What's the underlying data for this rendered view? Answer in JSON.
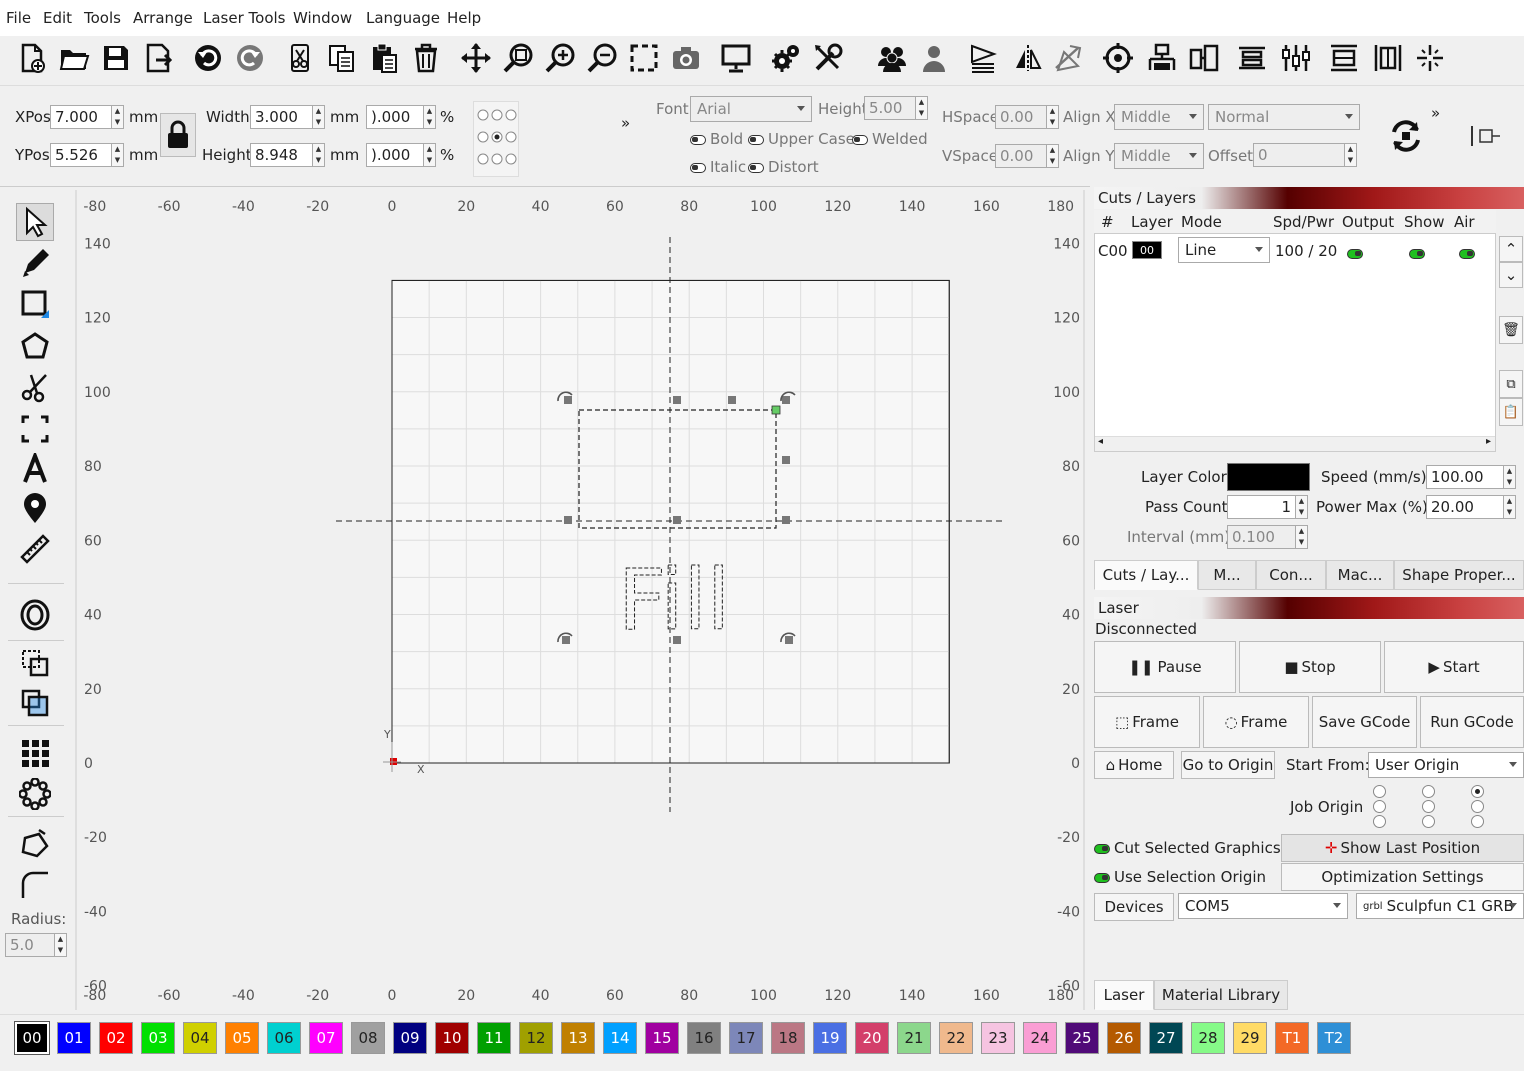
{
  "menu": [
    "File",
    "Edit",
    "Tools",
    "Arrange",
    "Laser Tools",
    "Window",
    "Language",
    "Help"
  ],
  "toolbar_icons": [
    "new-file-icon",
    "open-folder-icon",
    "save-icon",
    "export-icon",
    "undo-icon",
    "redo-icon",
    "cut-icon",
    "copy-icon",
    "paste-icon",
    "delete-icon",
    "move-icon",
    "zoom-to-page-icon",
    "zoom-in-icon",
    "zoom-out-icon",
    "select-frame-icon",
    "camera-icon",
    "monitor-icon",
    "settings-icon",
    "tools-icon",
    "group-icon",
    "ungroup-icon",
    "mirror-horizontal-icon",
    "flip-icon",
    "rotate-icon",
    "target-icon",
    "align-top-icon",
    "align-center-icon",
    "distribute-h-icon",
    "distribute-v-icon",
    "align-width-icon",
    "align-height-icon",
    "snap-icon"
  ],
  "props": {
    "xpos_label": "XPos",
    "xpos": "7.000",
    "ypos_label": "YPos",
    "ypos": "5.526",
    "unit_mm": "mm",
    "width_label": "Width",
    "width": "3.000",
    "height_label": "Height",
    "height": "8.948",
    "scale_w": ").000",
    "scale_h": ").000",
    "percent": "%",
    "more": "»",
    "font_label": "Font",
    "font": "Arial",
    "fheight_label": "Height",
    "fheight": "5.00",
    "bold": "Bold",
    "upper": "Upper Case",
    "welded": "Welded",
    "italic": "Italic",
    "distort": "Distort",
    "hspace_label": "HSpace",
    "hspace": "0.00",
    "vspace_label": "VSpace",
    "vspace": "0.00",
    "alignx_label": "Align X",
    "alignx": "Middle",
    "aligny_label": "Align Y",
    "aligny": "Middle",
    "normal": "Normal",
    "offset_label": "Offset",
    "offset": "0",
    "more2": "»"
  },
  "lefttools": [
    "select-arrow-icon",
    "pencil-icon",
    "rectangle-icon",
    "polygon-icon",
    "scissors-icon",
    "frame-icon",
    "text-tool-icon",
    "position-pin-icon",
    "ruler-icon",
    "offset-icon",
    "boolean-union-icon",
    "boolean-subtract-icon",
    "grid-array-icon",
    "circular-array-icon",
    "node-edit-icon",
    "corner-icon"
  ],
  "radius_label": "Radius:",
  "radius": "5.0",
  "ruler_x": [
    "-80",
    "-60",
    "-40",
    "-20",
    "0",
    "20",
    "40",
    "60",
    "80",
    "100",
    "120",
    "140",
    "160",
    "180"
  ],
  "ruler_y": [
    "140",
    "120",
    "100",
    "80",
    "60",
    "40",
    "20",
    "0",
    "-20",
    "-40",
    "-60"
  ],
  "canvas_text": "Fill",
  "axis_x": "X",
  "axis_y": "Y",
  "cuts": {
    "title": "Cuts / Layers",
    "headers": [
      "#",
      "Layer",
      "Mode",
      "Spd/Pwr",
      "Output",
      "Show",
      "Air"
    ],
    "row": {
      "num": "C00",
      "layer": "00",
      "mode": "Line",
      "spdpwr": "100 / 20"
    },
    "layer_color_label": "Layer Color",
    "speed_label": "Speed (mm/s)",
    "speed": "100.00",
    "pass_label": "Pass Count",
    "pass": "1",
    "power_label": "Power Max (%)",
    "power": "20.00",
    "interval_label": "Interval (mm)",
    "interval": "0.100",
    "tabs": [
      "Cuts / Lay...",
      "M...",
      "Con...",
      "Mac...",
      "Shape Proper..."
    ]
  },
  "laser": {
    "title": "Laser",
    "status": "Disconnected",
    "pause": "Pause",
    "stop": "Stop",
    "start": "Start",
    "frame1": "Frame",
    "frame2": "Frame",
    "save_gcode": "Save GCode",
    "run_gcode": "Run GCode",
    "home": "Home",
    "go_origin": "Go to Origin",
    "start_from_label": "Start From:",
    "start_from": "User Origin",
    "job_origin_label": "Job Origin",
    "cut_selected": "Cut Selected Graphics",
    "show_last": "Show Last Position",
    "use_sel_origin": "Use Selection Origin",
    "opt_settings": "Optimization Settings",
    "devices": "Devices",
    "port": "COM5",
    "device": "Sculpfun C1 GRB",
    "tabs": [
      "Laser",
      "Material Library"
    ]
  },
  "palette": [
    {
      "label": "00",
      "color": "#000000"
    },
    {
      "label": "01",
      "color": "#0000ff"
    },
    {
      "label": "02",
      "color": "#ff0000"
    },
    {
      "label": "03",
      "color": "#00e000"
    },
    {
      "label": "04",
      "color": "#d0d000"
    },
    {
      "label": "05",
      "color": "#ff8000"
    },
    {
      "label": "06",
      "color": "#00d0d0"
    },
    {
      "label": "07",
      "color": "#ff00ff"
    },
    {
      "label": "08",
      "color": "#a0a0a0"
    },
    {
      "label": "09",
      "color": "#000080"
    },
    {
      "label": "10",
      "color": "#a00000"
    },
    {
      "label": "11",
      "color": "#00a000"
    },
    {
      "label": "12",
      "color": "#a0a000"
    },
    {
      "label": "13",
      "color": "#c08000"
    },
    {
      "label": "14",
      "color": "#00a0ff"
    },
    {
      "label": "15",
      "color": "#a000a0"
    },
    {
      "label": "16",
      "color": "#808080"
    },
    {
      "label": "17",
      "color": "#7d87b9"
    },
    {
      "label": "18",
      "color": "#bb7784"
    },
    {
      "label": "19",
      "color": "#4a6fe3"
    },
    {
      "label": "20",
      "color": "#d33f6a"
    },
    {
      "label": "21",
      "color": "#8cd78c"
    },
    {
      "label": "22",
      "color": "#f0b98d"
    },
    {
      "label": "23",
      "color": "#f6c4e1"
    },
    {
      "label": "24",
      "color": "#fa9ed4"
    },
    {
      "label": "25",
      "color": "#500a78"
    },
    {
      "label": "26",
      "color": "#b45a00"
    },
    {
      "label": "27",
      "color": "#004754"
    },
    {
      "label": "28",
      "color": "#86fa88"
    },
    {
      "label": "29",
      "color": "#ffdb66"
    },
    {
      "label": "T1",
      "color": "#f36926"
    },
    {
      "label": "T2",
      "color": "#2e8fd6"
    }
  ]
}
